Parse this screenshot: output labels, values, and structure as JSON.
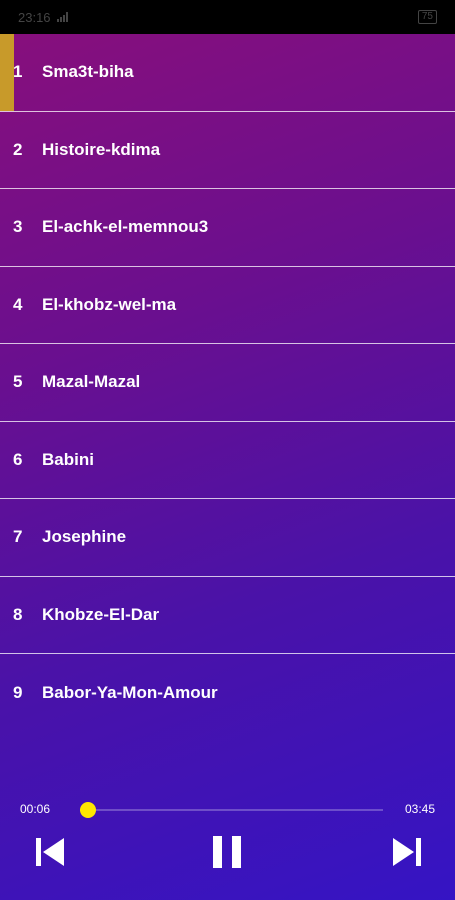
{
  "status_bar": {
    "time": "23:16",
    "battery": "75"
  },
  "tracks": [
    {
      "number": "1",
      "title": "Sma3t-biha"
    },
    {
      "number": "2",
      "title": "Histoire-kdima"
    },
    {
      "number": "3",
      "title": "El-achk-el-memnou3"
    },
    {
      "number": "4",
      "title": "El-khobz-wel-ma"
    },
    {
      "number": "5",
      "title": "Mazal-Mazal"
    },
    {
      "number": "6",
      "title": "Babini"
    },
    {
      "number": "7",
      "title": "Josephine"
    },
    {
      "number": "8",
      "title": "Khobze-El-Dar"
    },
    {
      "number": "9",
      "title": "Babor-Ya-Mon-Amour"
    }
  ],
  "player": {
    "current_time": "00:06",
    "total_time": "03:45",
    "progress_fraction": 0.027,
    "state": "playing"
  },
  "colors": {
    "active_marker": "#c89a2a",
    "seek_thumb": "#ffe600",
    "gradient_top": "#8a0f7a",
    "gradient_bottom": "#3514c4"
  },
  "icons": {
    "prev": "skip-previous-icon",
    "pause": "pause-icon",
    "next": "skip-next-icon"
  }
}
